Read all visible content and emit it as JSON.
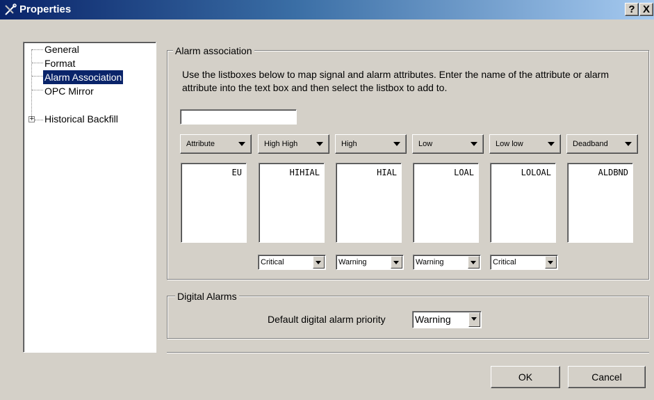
{
  "window": {
    "title": "Properties",
    "help_label": "?",
    "close_label": "X"
  },
  "tree": {
    "items": [
      {
        "label": "General",
        "selected": false,
        "expandable": false
      },
      {
        "label": "Format",
        "selected": false,
        "expandable": false
      },
      {
        "label": "Alarm Association",
        "selected": true,
        "expandable": false
      },
      {
        "label": "OPC Mirror",
        "selected": false,
        "expandable": false
      },
      {
        "label": "Historical Backfill",
        "selected": false,
        "expandable": true
      }
    ]
  },
  "alarm_association": {
    "group_label": "Alarm association",
    "instructions": "Use the listboxes below to map signal and alarm attributes. Enter the name of the attribute or alarm attribute into the text box and then select the listbox to add to.",
    "attribute_input_value": "",
    "columns": [
      {
        "header": "Attribute",
        "list_items": [
          "EU"
        ],
        "priority": null
      },
      {
        "header": "High High",
        "list_items": [
          "HIHIAL"
        ],
        "priority": "Critical"
      },
      {
        "header": "High",
        "list_items": [
          "HIAL"
        ],
        "priority": "Warning"
      },
      {
        "header": "Low",
        "list_items": [
          "LOAL"
        ],
        "priority": "Warning"
      },
      {
        "header": "Low low",
        "list_items": [
          "LOLOAL"
        ],
        "priority": "Critical"
      },
      {
        "header": "Deadband",
        "list_items": [
          "ALDBND"
        ],
        "priority": null
      }
    ]
  },
  "digital_alarms": {
    "group_label": "Digital Alarms",
    "priority_label": "Default digital alarm priority",
    "priority_value": "Warning"
  },
  "buttons": {
    "ok_label": "OK",
    "cancel_label": "Cancel"
  },
  "colors": {
    "selection": "#0a246a",
    "titlebar_start": "#0a246a",
    "titlebar_end": "#a6caf0",
    "dialog_face": "#d4d0c8"
  }
}
